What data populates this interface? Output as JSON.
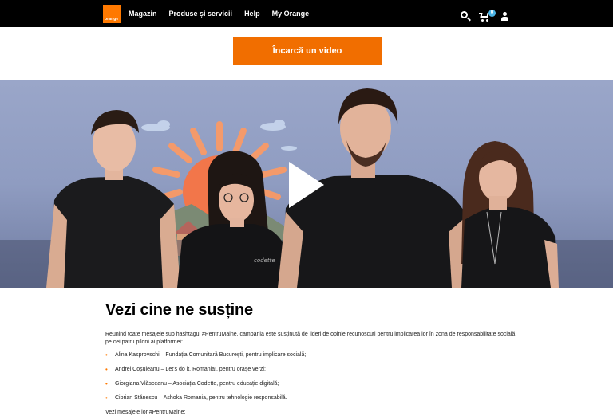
{
  "header": {
    "logo_text": "orange",
    "nav": [
      {
        "label": "Magazin"
      },
      {
        "label": "Produse și servicii"
      },
      {
        "label": "Help"
      },
      {
        "label": "My Orange"
      }
    ],
    "cart_count": "0",
    "icons": [
      "search-icon",
      "cart-icon",
      "user-icon"
    ]
  },
  "upload_button": "Încarcă un video",
  "video": {
    "state": "paused",
    "icon": "play-icon"
  },
  "section": {
    "title": "Vezi cine ne susține",
    "intro": "Reunind toate mesajele sub hashtagul #PentruMaine, campania este susținută de lideri de opinie recunoscuți pentru implicarea lor în zona de responsabilitate socială pe cei patru piloni ai platformei:",
    "supporters": [
      "Alina Kasprovschi – Fundația Comunitară București, pentru implicare socială;",
      "Andrei Coșuleanu – Let's do it, Romania!, pentru orașe verzi;",
      "Giorgiana Vlăsceanu – Asociația Codette, pentru educație digitală;",
      "Ciprian Stănescu – Ashoka Romania, pentru tehnologie responsabilă."
    ],
    "footer": "Vezi mesajele lor #PentruMaine:"
  },
  "colors": {
    "brand_orange": "#ff7900",
    "button_orange": "#f16e00",
    "header_bg": "#000000",
    "badge_blue": "#4bb4e6"
  }
}
